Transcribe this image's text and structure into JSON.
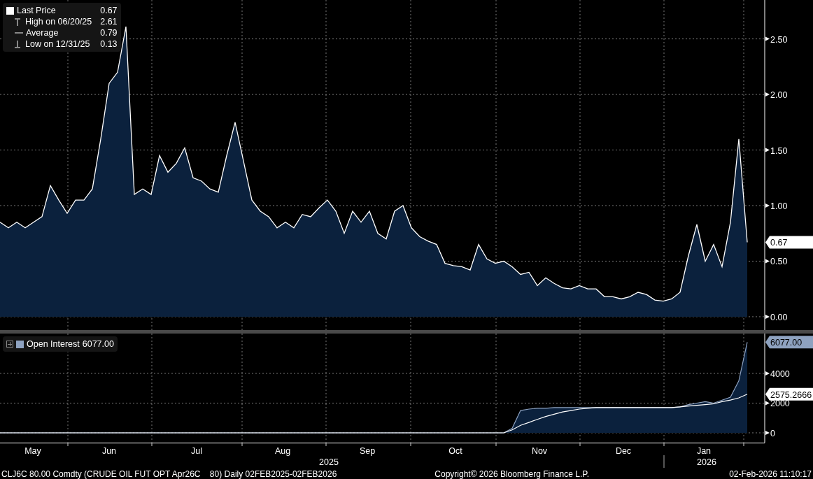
{
  "price_chart": {
    "legend": [
      {
        "kind": "square",
        "value": "0.67"
      },
      {
        "kind": "high",
        "label": "High on 06/20/25",
        "value": "2.61"
      },
      {
        "kind": "average",
        "label": "Average",
        "value": "0.79"
      },
      {
        "kind": "low",
        "label": "Low on 12/31/25",
        "value": "0.13"
      }
    ],
    "last_label": "0.67",
    "chart_data": {
      "type": "area",
      "grid": true,
      "ylim": [
        -0.12,
        2.85
      ],
      "yticks": [
        {
          "value": 0,
          "label": "0.00"
        },
        {
          "value": 0.5,
          "label": "0.50"
        },
        {
          "value": 1,
          "label": "1.00"
        },
        {
          "value": 1.5,
          "label": "1.50"
        },
        {
          "value": 2,
          "label": "2.00"
        },
        {
          "value": 2.5,
          "label": "2.50"
        }
      ],
      "series": [
        {
          "name": "Last Price",
          "color": "#ffffff",
          "values": [
            0.85,
            0.8,
            0.85,
            0.8,
            0.85,
            0.9,
            1.18,
            1.05,
            0.93,
            1.05,
            1.05,
            1.15,
            1.6,
            2.1,
            2.2,
            2.61,
            1.1,
            1.15,
            1.1,
            1.45,
            1.3,
            1.38,
            1.52,
            1.25,
            1.22,
            1.15,
            1.12,
            1.45,
            1.75,
            1.4,
            1.05,
            0.95,
            0.9,
            0.8,
            0.85,
            0.8,
            0.92,
            0.9,
            0.98,
            1.05,
            0.95,
            0.75,
            0.95,
            0.85,
            0.95,
            0.75,
            0.7,
            0.95,
            1.0,
            0.8,
            0.72,
            0.68,
            0.65,
            0.48,
            0.46,
            0.45,
            0.42,
            0.65,
            0.52,
            0.48,
            0.5,
            0.45,
            0.38,
            0.4,
            0.28,
            0.35,
            0.3,
            0.26,
            0.25,
            0.28,
            0.25,
            0.25,
            0.18,
            0.18,
            0.16,
            0.18,
            0.22,
            0.2,
            0.15,
            0.14,
            0.16,
            0.22,
            0.55,
            0.83,
            0.5,
            0.65,
            0.45,
            0.85,
            1.6,
            0.67
          ]
        }
      ]
    }
  },
  "oi_chart": {
    "legend": {
      "value": "6077.00"
    },
    "last_labels": [
      "6077.00",
      "2575.2666"
    ],
    "chart_data": {
      "type": "area",
      "grid": true,
      "ylim": [
        -660,
        6680
      ],
      "yticks": [
        {
          "value": 0,
          "label": "0"
        },
        {
          "value": 2000,
          "label": "2000"
        },
        {
          "value": 4000,
          "label": "4000"
        }
      ],
      "series": [
        {
          "name": "Open Interest",
          "color": "#8ea2c0",
          "values": [
            0,
            0,
            0,
            0,
            0,
            0,
            0,
            0,
            0,
            0,
            0,
            0,
            0,
            0,
            0,
            0,
            0,
            0,
            0,
            0,
            0,
            0,
            0,
            0,
            0,
            0,
            0,
            0,
            0,
            0,
            0,
            0,
            0,
            0,
            0,
            0,
            0,
            0,
            0,
            0,
            0,
            0,
            0,
            0,
            0,
            0,
            0,
            0,
            0,
            0,
            0,
            0,
            0,
            0,
            0,
            0,
            0,
            0,
            0,
            0,
            0,
            300,
            1500,
            1600,
            1650,
            1650,
            1700,
            1700,
            1700,
            1700,
            1700,
            1700,
            1700,
            1700,
            1700,
            1700,
            1700,
            1700,
            1700,
            1700,
            1700,
            1750,
            1900,
            2000,
            2100,
            2000,
            2200,
            2400,
            3500,
            6100
          ]
        },
        {
          "type": "line",
          "color": "#ffffff",
          "values": [
            0,
            0,
            0,
            0,
            0,
            0,
            0,
            0,
            0,
            0,
            0,
            0,
            0,
            0,
            0,
            0,
            0,
            0,
            0,
            0,
            0,
            0,
            0,
            0,
            0,
            0,
            0,
            0,
            0,
            0,
            0,
            0,
            0,
            0,
            0,
            0,
            0,
            0,
            0,
            0,
            0,
            0,
            0,
            0,
            0,
            0,
            0,
            0,
            0,
            0,
            0,
            0,
            0,
            0,
            0,
            0,
            0,
            0,
            0,
            0,
            0,
            200,
            500,
            700,
            900,
            1100,
            1250,
            1400,
            1500,
            1600,
            1650,
            1700,
            1700,
            1700,
            1700,
            1700,
            1700,
            1700,
            1700,
            1700,
            1700,
            1750,
            1800,
            1850,
            1900,
            1950,
            2100,
            2200,
            2350,
            2600
          ]
        }
      ]
    }
  },
  "months": [
    "May",
    "Jun",
    "Jul",
    "Aug",
    "Sep",
    "Oct",
    "Nov",
    "Dec",
    "Jan"
  ],
  "year_labels": [
    "2025",
    "2026"
  ],
  "footer": {
    "security": "CLJ6C 80.00 Comdty (CRUDE OIL FUT OPT Apr26C    80) Daily 02FEB2025-02FEB2026",
    "copyright": "Copyright© 2026 Bloomberg Finance L.P.",
    "timestamp": "02-Feb-2026 11:10:17"
  }
}
